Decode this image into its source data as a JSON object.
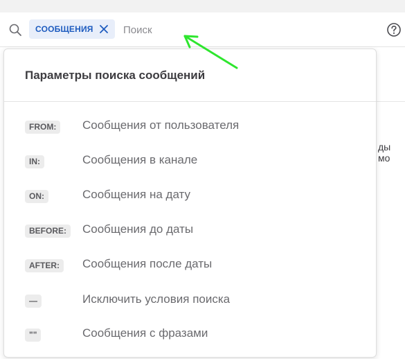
{
  "search": {
    "chip_label": "СООБЩЕНИЯ",
    "placeholder": "Поиск"
  },
  "popover": {
    "title": "Параметры поиска сообщений",
    "options": [
      {
        "tag": "FROM:",
        "label": "Сообщения от пользователя"
      },
      {
        "tag": "IN:",
        "label": "Сообщения в канале"
      },
      {
        "tag": "ON:",
        "label": "Сообщения на дату"
      },
      {
        "tag": "BEFORE:",
        "label": "Сообщения до даты"
      },
      {
        "tag": "AFTER:",
        "label": "Сообщения после даты"
      },
      {
        "tag": "—",
        "label": "Исключить условия поиска"
      },
      {
        "tag": "\"\"",
        "label": "Сообщения с фразами"
      }
    ]
  },
  "background": {
    "right_fragment": "ды мо"
  },
  "icons": {
    "search": "search-icon",
    "chip_close": "close-icon",
    "help": "help-circle-icon",
    "annotation": "green-arrow-icon"
  },
  "colors": {
    "chip_bg": "#e8eefa",
    "chip_text": "#1d5bbf",
    "annotation_arrow": "#2ee62e"
  }
}
